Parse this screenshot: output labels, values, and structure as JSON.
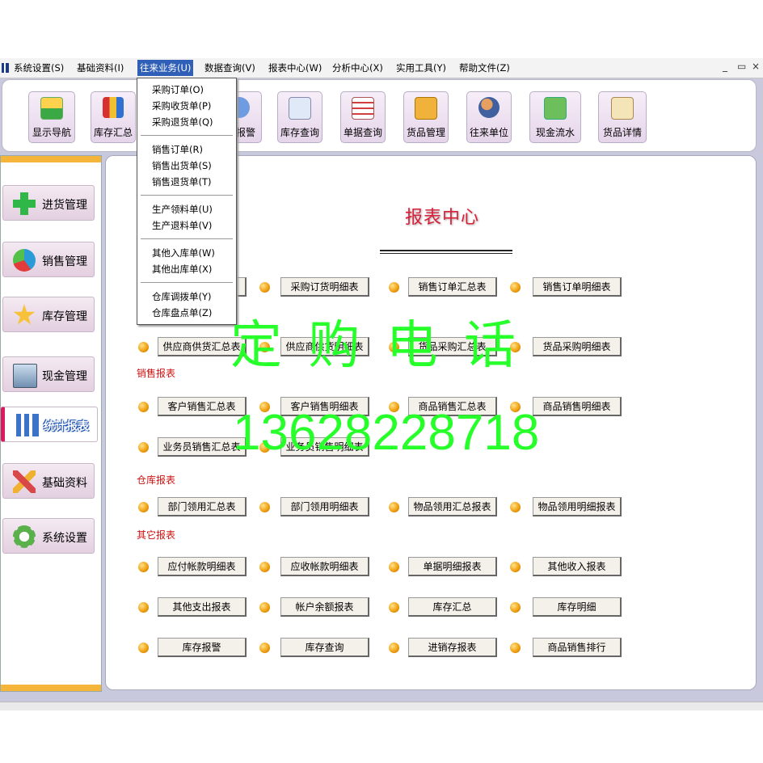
{
  "menubar": {
    "items": [
      "系统设置(S)",
      "基础资料(I)",
      "往来业务(U)",
      "数据查询(V)",
      "报表中心(W)",
      "分析中心(X)",
      "实用工具(Y)",
      "帮助文件(Z)"
    ],
    "window_controls": [
      "_",
      "ｮ",
      "×"
    ]
  },
  "toolbar": {
    "buttons": [
      {
        "label": "显示导航",
        "icon": "navigation-grid-icon"
      },
      {
        "label": "库存汇总",
        "icon": "bar-chart-icon"
      },
      {
        "label": "报警",
        "icon": "alarm-icon"
      },
      {
        "label": "库存查询",
        "icon": "search-document-icon"
      },
      {
        "label": "单据查询",
        "icon": "table-icon"
      },
      {
        "label": "货品管理",
        "icon": "goods-box-icon"
      },
      {
        "label": "往来单位",
        "icon": "people-icon"
      },
      {
        "label": "现金流水",
        "icon": "cash-icon"
      },
      {
        "label": "货品详情",
        "icon": "clipboard-icon"
      }
    ]
  },
  "sidebar": {
    "items": [
      {
        "label": "进货管理",
        "icon": "plus-icon"
      },
      {
        "label": "销售管理",
        "icon": "pie-icon"
      },
      {
        "label": "库存管理",
        "icon": "star-icon"
      },
      {
        "label": "现金管理",
        "icon": "cash-register-icon"
      },
      {
        "label": "统计报表",
        "icon": "bar-chart-icon",
        "active": true
      },
      {
        "label": "基础资料",
        "icon": "tools-icon"
      },
      {
        "label": "系统设置",
        "icon": "gear-icon"
      }
    ]
  },
  "main": {
    "title": "报表中心",
    "sections": {
      "sales": "销售报表",
      "warehouse": "仓库报表",
      "other": "其它报表"
    },
    "buttons": {
      "row1": [
        "",
        "采购订货明细表",
        "销售订单汇总表",
        "销售订单明细表"
      ],
      "row2": [
        "供应商供货汇总表",
        "供应商供货明细表",
        "货品采购汇总表",
        "货品采购明细表"
      ],
      "row3": [
        "客户销售汇总表",
        "客户销售明细表",
        "商品销售汇总表",
        "商品销售明细表"
      ],
      "row4": [
        "业务员销售汇总表",
        "业务员销售明细表"
      ],
      "row5": [
        "部门领用汇总表",
        "部门领用明细表",
        "物品领用汇总报表",
        "物品领用明细报表"
      ],
      "row6": [
        "应付帐款明细表",
        "应收帐款明细表",
        "单据明细报表",
        "其他收入报表"
      ],
      "row7": [
        "其他支出报表",
        "帐户余额报表",
        "库存汇总",
        "库存明细"
      ],
      "row8": [
        "库存报警",
        "库存查询",
        "进销存报表",
        "商品销售排行"
      ]
    }
  },
  "dropdown": {
    "items": [
      "采购订单(O)",
      "采购收货单(P)",
      "采购退货单(Q)",
      "销售订单(R)",
      "销售出货单(S)",
      "销售退货单(T)",
      "生产领料单(U)",
      "生产退料单(V)",
      "其他入库单(W)",
      "其他出库单(X)",
      "仓库调拨单(Y)",
      "仓库盘点单(Z)"
    ]
  },
  "watermark": {
    "line1": "定 购 电 话",
    "line2": "13628228718",
    "color": "#27ff2a"
  },
  "colors": {
    "menu_active": "#2f5fb7",
    "section_label": "#cc1111",
    "title": "#d8203a",
    "sidebar_accent": "#f5b43a",
    "sidebar_active_marker": "#d81b60"
  }
}
